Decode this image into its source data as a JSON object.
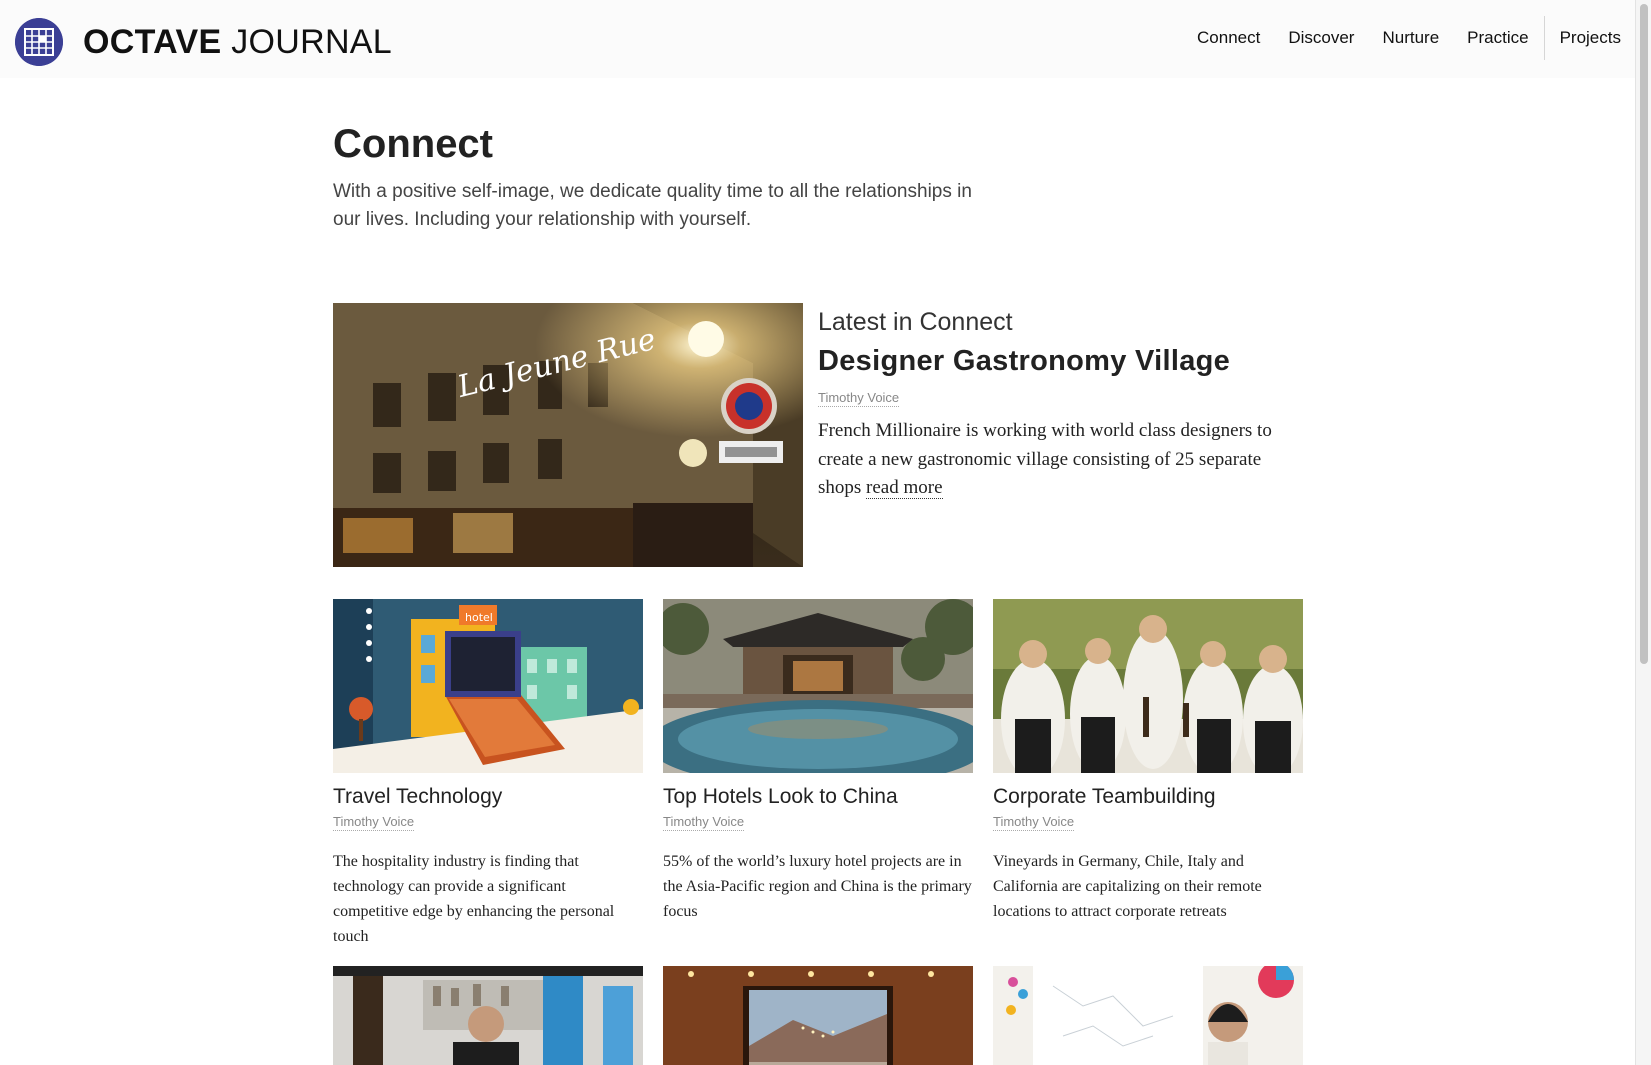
{
  "header": {
    "brand_bold": "OCTAVE",
    "brand_light": "JOURNAL",
    "nav": [
      "Connect",
      "Discover",
      "Nurture",
      "Practice",
      "Projects"
    ]
  },
  "page": {
    "title": "Connect",
    "intro": "With a positive self-image, we dedicate quality time to all the relationships in our lives. Including your relationship with yourself."
  },
  "featured": {
    "kicker": "Latest in Connect",
    "title": "Designer Gastronomy Village",
    "author": "Timothy Voice",
    "body": "French Millionaire is working with world class designers to create a new gastronomic village consisting of 25 separate shops",
    "read_more": "read more",
    "neon_sign": "La Jeune Rue"
  },
  "cards": [
    {
      "title": "Travel Technology",
      "author": "Timothy Voice",
      "body": "The hospitality industry is finding that technology can provide a significant competitive edge by enhancing the personal touch"
    },
    {
      "title": "Top Hotels Look to China",
      "author": "Timothy Voice",
      "body": "55% of the world’s luxury hotel projects are in the Asia-Pacific region and China is the primary focus"
    },
    {
      "title": "Corporate Teambuilding",
      "author": "Timothy Voice",
      "body": "Vineyards in Germany, Chile, Italy and California are capitalizing on their remote locations to attract corporate retreats"
    }
  ],
  "colors": {
    "logo": "#3b3f95",
    "text": "#222222",
    "muted": "#888888"
  }
}
